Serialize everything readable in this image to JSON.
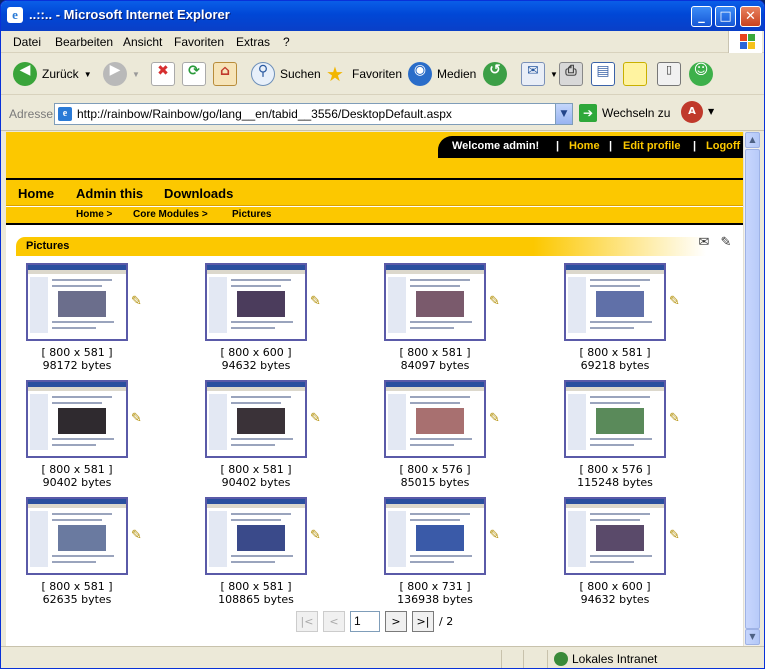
{
  "window": {
    "title": "..::.. - Microsoft Internet Explorer",
    "min": "_",
    "max": "□",
    "close": "✕"
  },
  "menu": {
    "items": [
      "Datei",
      "Bearbeiten",
      "Ansicht",
      "Favoriten",
      "Extras",
      "?"
    ]
  },
  "toolbar": {
    "back": "Zurück",
    "search": "Suchen",
    "favorites": "Favoriten",
    "media": "Medien"
  },
  "address": {
    "label": "Adresse",
    "url": "http://rainbow/Rainbow/go/lang__en/tabid__3556/DesktopDefault.aspx",
    "go": "Wechseln zu"
  },
  "header": {
    "welcome": "Welcome admin!",
    "home": "Home",
    "edit_profile": "Edit profile",
    "logoff": "Logoff",
    "sep": "|"
  },
  "nav": {
    "home": "Home",
    "admin": "Admin this",
    "downloads": "Downloads"
  },
  "breadcrumb": {
    "home": "Home >",
    "core": "Core Modules >",
    "pictures": "Pictures"
  },
  "module": {
    "title": "Pictures"
  },
  "pictures": [
    {
      "dims": "[ 800 x 581 ]",
      "bytes": "98172 bytes"
    },
    {
      "dims": "[ 800 x 600 ]",
      "bytes": "94632 bytes"
    },
    {
      "dims": "[ 800 x 581 ]",
      "bytes": "84097 bytes"
    },
    {
      "dims": "[ 800 x 581 ]",
      "bytes": "69218 bytes"
    },
    {
      "dims": "[ 800 x 581 ]",
      "bytes": "90402 bytes"
    },
    {
      "dims": "[ 800 x 581 ]",
      "bytes": "90402 bytes"
    },
    {
      "dims": "[ 800 x 576 ]",
      "bytes": "85015 bytes"
    },
    {
      "dims": "[ 800 x 576 ]",
      "bytes": "115248 bytes"
    },
    {
      "dims": "[ 800 x 581 ]",
      "bytes": "62635 bytes"
    },
    {
      "dims": "[ 800 x 581 ]",
      "bytes": "108865 bytes"
    },
    {
      "dims": "[ 800 x 731 ]",
      "bytes": "136938 bytes"
    },
    {
      "dims": "[ 800 x 600 ]",
      "bytes": "94632 bytes"
    }
  ],
  "pager": {
    "first": "|<",
    "prev": "<",
    "page": "1",
    "next": ">",
    "last": ">|",
    "total": "/ 2"
  },
  "status": {
    "zone": "Lokales Intranet"
  }
}
